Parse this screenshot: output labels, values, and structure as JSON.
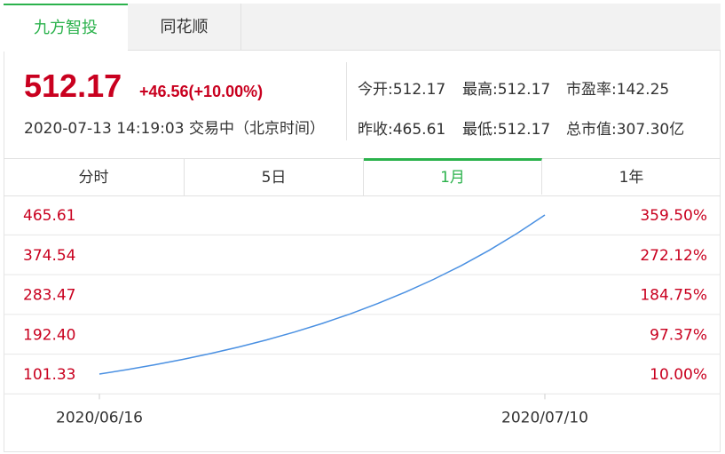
{
  "tabs": [
    {
      "label": "九方智投",
      "active": true
    },
    {
      "label": "同花顺",
      "active": false
    }
  ],
  "quote": {
    "price": "512.17",
    "change": "+46.56(+10.00%)",
    "datetime": "2020-07-13 14:19:03 交易中（北京时间）",
    "stats": {
      "open": "今开:512.17",
      "high": "最高:512.17",
      "pe": "市盈率:142.25",
      "prev_close": "昨收:465.61",
      "low": "最低:512.17",
      "market_cap": "总市值:307.30亿"
    }
  },
  "period_tabs": [
    {
      "label": "分时",
      "active": false
    },
    {
      "label": "5日",
      "active": false
    },
    {
      "label": "1月",
      "active": true
    },
    {
      "label": "1年",
      "active": false
    }
  ],
  "colors": {
    "accent_green": "#2bb24c",
    "price_red": "#c9001f",
    "line_blue": "#4a90e2",
    "grid": "#e6e6e6"
  },
  "chart_data": {
    "type": "line",
    "x_start": "2020/06/16",
    "x_end": "2020/07/10",
    "xtick_labels": [
      "2020/06/16",
      "2020/07/10"
    ],
    "y_ticks_left": [
      "465.61",
      "374.54",
      "283.47",
      "192.40",
      "101.33"
    ],
    "y_ticks_right": [
      "359.50%",
      "272.12%",
      "184.75%",
      "97.37%",
      "10.00%"
    ],
    "ylim": [
      101.33,
      465.61
    ],
    "grid": true,
    "series": [
      {
        "values": [
          101.33,
          111.46,
          122.61,
          134.87,
          148.36,
          163.19,
          179.51,
          197.46,
          217.21,
          238.93,
          262.82,
          289.11,
          318.02,
          349.82,
          384.8,
          423.28,
          465.61
        ]
      }
    ]
  }
}
